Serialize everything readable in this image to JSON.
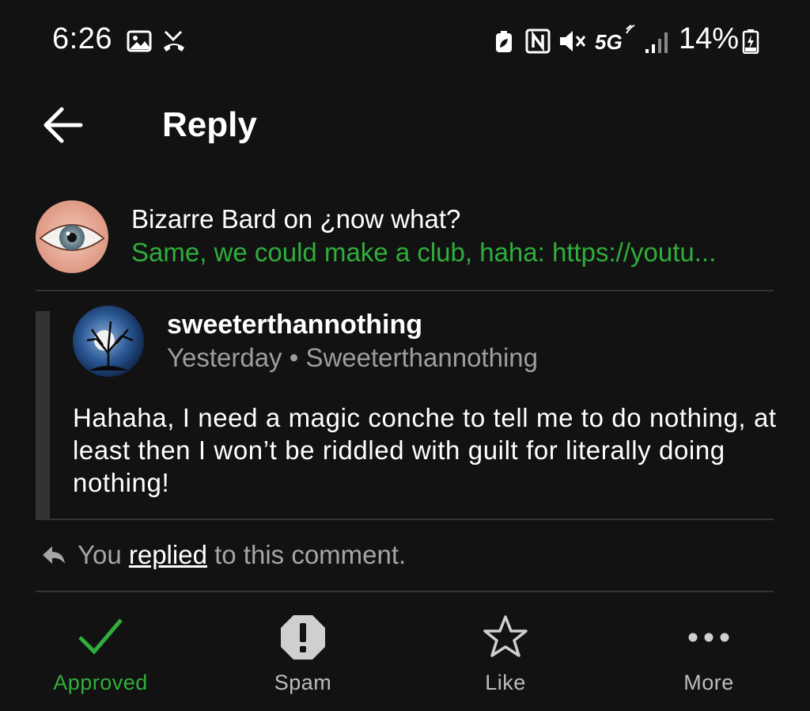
{
  "status_bar": {
    "time": "6:26",
    "network": "5G",
    "battery": "14%"
  },
  "app_bar": {
    "title": "Reply"
  },
  "context": {
    "title": "Bizarre Bard on ¿now what?",
    "snippet": "Same, we could make a club, haha: https://youtu..."
  },
  "comment": {
    "author": "sweeterthannothing",
    "meta": "Yesterday • Sweeterthannothing",
    "body": "Hahaha, I need a magic conche to tell me to do nothing, at least then I won’t be riddled with guilt for literally doing nothing!"
  },
  "replied": {
    "prefix": "You",
    "link": "replied",
    "suffix": "to this comment."
  },
  "actions": [
    {
      "label": "Approved",
      "icon": "check-icon"
    },
    {
      "label": "Spam",
      "icon": "spam-octagon-icon"
    },
    {
      "label": "Like",
      "icon": "star-icon"
    },
    {
      "label": "More",
      "icon": "more-dots-icon"
    }
  ],
  "colors": {
    "background": "#121212",
    "accent_green": "#2fae3b",
    "divider": "#333333",
    "muted_text": "#9e9e9e"
  }
}
